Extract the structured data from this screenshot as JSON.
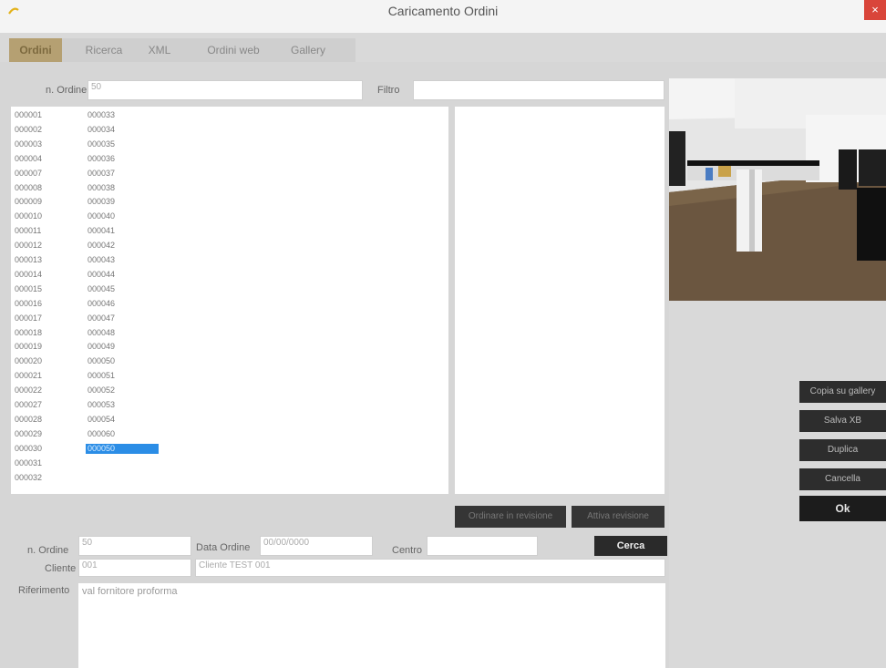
{
  "window": {
    "title": "Caricamento Ordini",
    "close_label": "×"
  },
  "tabs": [
    {
      "label": "Ordini"
    },
    {
      "label": "Ricerca"
    },
    {
      "label": "XML"
    },
    {
      "label": "Ordini web"
    },
    {
      "label": "Gallery"
    }
  ],
  "search": {
    "order_label": "n. Ordine",
    "order_value": "50",
    "filter_label": "Filtro",
    "filter_value": ""
  },
  "orders": [
    {
      "a": "000001",
      "b": "000033"
    },
    {
      "a": "000002",
      "b": "000034"
    },
    {
      "a": "000003",
      "b": "000035"
    },
    {
      "a": "000004",
      "b": "000036"
    },
    {
      "a": "000007",
      "b": "000037"
    },
    {
      "a": "000008",
      "b": "000038"
    },
    {
      "a": "000009",
      "b": "000039"
    },
    {
      "a": "000010",
      "b": "000040"
    },
    {
      "a": "000011",
      "b": "000041"
    },
    {
      "a": "000012",
      "b": "000042"
    },
    {
      "a": "000013",
      "b": "000043"
    },
    {
      "a": "000014",
      "b": "000044"
    },
    {
      "a": "000015",
      "b": "000045"
    },
    {
      "a": "000016",
      "b": "000046"
    },
    {
      "a": "000017",
      "b": "000047"
    },
    {
      "a": "000018",
      "b": "000048"
    },
    {
      "a": "000019",
      "b": "000049"
    },
    {
      "a": "000020",
      "b": "000050"
    },
    {
      "a": "000021",
      "b": "000051"
    },
    {
      "a": "000022",
      "b": "000052"
    },
    {
      "a": "000027",
      "b": "000053"
    },
    {
      "a": "000028",
      "b": "000054"
    },
    {
      "a": "000029",
      "b": "000060"
    },
    {
      "a": "000030",
      "b": "000050",
      "selected": true
    },
    {
      "a": "000031",
      "b": ""
    },
    {
      "a": "000032",
      "b": ""
    }
  ],
  "actions": {
    "mid1": "Ordinare in revisione",
    "mid2": "Attiva revisione"
  },
  "side_buttons": [
    "Copia su gallery",
    "Salva XB",
    "Duplica",
    "Cancella",
    "Ok"
  ],
  "details": {
    "order_label": "n. Ordine",
    "order_value": "50",
    "date_label": "Data Ordine",
    "date_value": "00/00/0000",
    "center_label": "Centro",
    "center_value": "",
    "search_button": "Cerca",
    "client_label": "Cliente",
    "client_code": "001",
    "client_name": "Cliente TEST 001",
    "notes_label": "Riferimento",
    "notes_value": "val fornitore proforma"
  }
}
